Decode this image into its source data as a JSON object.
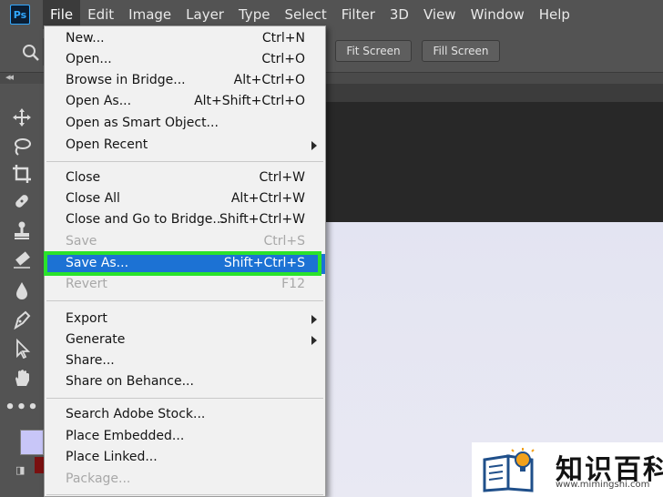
{
  "app": {
    "logo": "Ps"
  },
  "menubar": {
    "items": [
      "File",
      "Edit",
      "Image",
      "Layer",
      "Type",
      "Select",
      "Filter",
      "3D",
      "View",
      "Window",
      "Help"
    ]
  },
  "options_bar": {
    "fit_screen_label": "Fit Screen",
    "fill_screen_label": "Fill Screen"
  },
  "file_menu": {
    "items": [
      {
        "label": "New...",
        "shortcut": "Ctrl+N"
      },
      {
        "label": "Open...",
        "shortcut": "Ctrl+O"
      },
      {
        "label": "Browse in Bridge...",
        "shortcut": "Alt+Ctrl+O"
      },
      {
        "label": "Open As...",
        "shortcut": "Alt+Shift+Ctrl+O"
      },
      {
        "label": "Open as Smart Object...",
        "shortcut": ""
      },
      {
        "label": "Open Recent",
        "shortcut": ""
      },
      {
        "label": "Close",
        "shortcut": "Ctrl+W"
      },
      {
        "label": "Close All",
        "shortcut": "Alt+Ctrl+W"
      },
      {
        "label": "Close and Go to Bridge...",
        "shortcut": "Shift+Ctrl+W"
      },
      {
        "label": "Save",
        "shortcut": "Ctrl+S"
      },
      {
        "label": "Save As...",
        "shortcut": "Shift+Ctrl+S"
      },
      {
        "label": "Revert",
        "shortcut": "F12"
      },
      {
        "label": "Export",
        "shortcut": ""
      },
      {
        "label": "Generate",
        "shortcut": ""
      },
      {
        "label": "Share...",
        "shortcut": ""
      },
      {
        "label": "Share on Behance...",
        "shortcut": ""
      },
      {
        "label": "Search Adobe Stock...",
        "shortcut": ""
      },
      {
        "label": "Place Embedded...",
        "shortcut": ""
      },
      {
        "label": "Place Linked...",
        "shortcut": ""
      },
      {
        "label": "Package...",
        "shortcut": ""
      }
    ]
  },
  "colors": {
    "highlight": "#1c72d4",
    "callout": "#2be22b",
    "foreground_swatch": "#c8c6f8",
    "background_swatch": "#7a1010"
  },
  "toolbar": {
    "icons": [
      "move-icon",
      "lasso-icon",
      "crop-icon",
      "healing-brush-icon",
      "clone-stamp-icon",
      "eraser-icon",
      "blur-icon",
      "pen-icon",
      "path-selection-icon",
      "hand-icon",
      "more-tools-icon"
    ]
  },
  "watermark": {
    "title": "知识百科",
    "url": "www.mimingshi.com"
  }
}
